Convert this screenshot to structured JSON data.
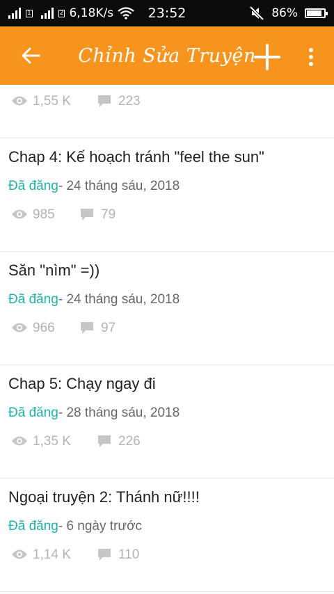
{
  "status_bar": {
    "network_speed": "6,18K/s",
    "time": "23:52",
    "battery": "86%",
    "battery_level": 0.86
  },
  "toolbar": {
    "title": "Chỉnh Sửa Truyện"
  },
  "partial_item": {
    "views": "1,55 K",
    "comments": "223"
  },
  "items": [
    {
      "title": "Chap 4: Kế hoạch tránh \"feel the sun\"",
      "status": "Đã đăng",
      "date": "- 24 tháng sáu, 2018",
      "views": "985",
      "comments": "79"
    },
    {
      "title": "Săn \"nìm\" =))",
      "status": "Đã đăng",
      "date": "- 24 tháng sáu, 2018",
      "views": "966",
      "comments": "97"
    },
    {
      "title": "Chap 5: Chạy ngay đi",
      "status": "Đã đăng",
      "date": "- 28 tháng sáu, 2018",
      "views": "1,35 K",
      "comments": "226"
    },
    {
      "title": "Ngoại truyện 2: Thánh nữ!!!!",
      "status": "Đã đăng",
      "date": "- 6 ngày trước",
      "views": "1,14 K",
      "comments": "110"
    }
  ],
  "colors": {
    "toolbar": "#f7941d",
    "published": "#1fb3a9",
    "stats": "#b3b3b3"
  }
}
